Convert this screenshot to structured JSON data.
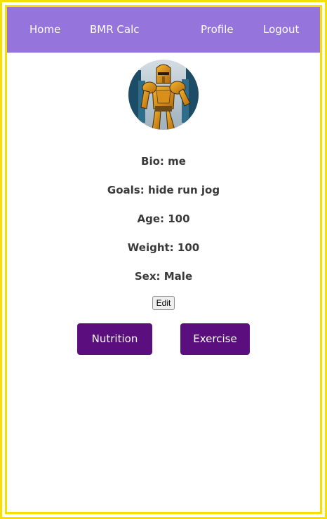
{
  "nav": {
    "home": "Home",
    "bmr": "BMR Calc",
    "profile": "Profile",
    "logout": "Logout"
  },
  "profile": {
    "bio": "Bio: me",
    "goals": "Goals: hide run jog",
    "age": "Age: 100",
    "weight": "Weight: 100",
    "sex": "Sex: Male"
  },
  "actions": {
    "edit": "Edit",
    "nutrition": "Nutrition",
    "exercise": "Exercise"
  },
  "colors": {
    "frame": "#f5e000",
    "navbar": "#9575dc",
    "button": "#5b0f7e",
    "text": "#3a3a3a"
  },
  "avatar": {
    "icon": "knight-avatar-icon"
  }
}
